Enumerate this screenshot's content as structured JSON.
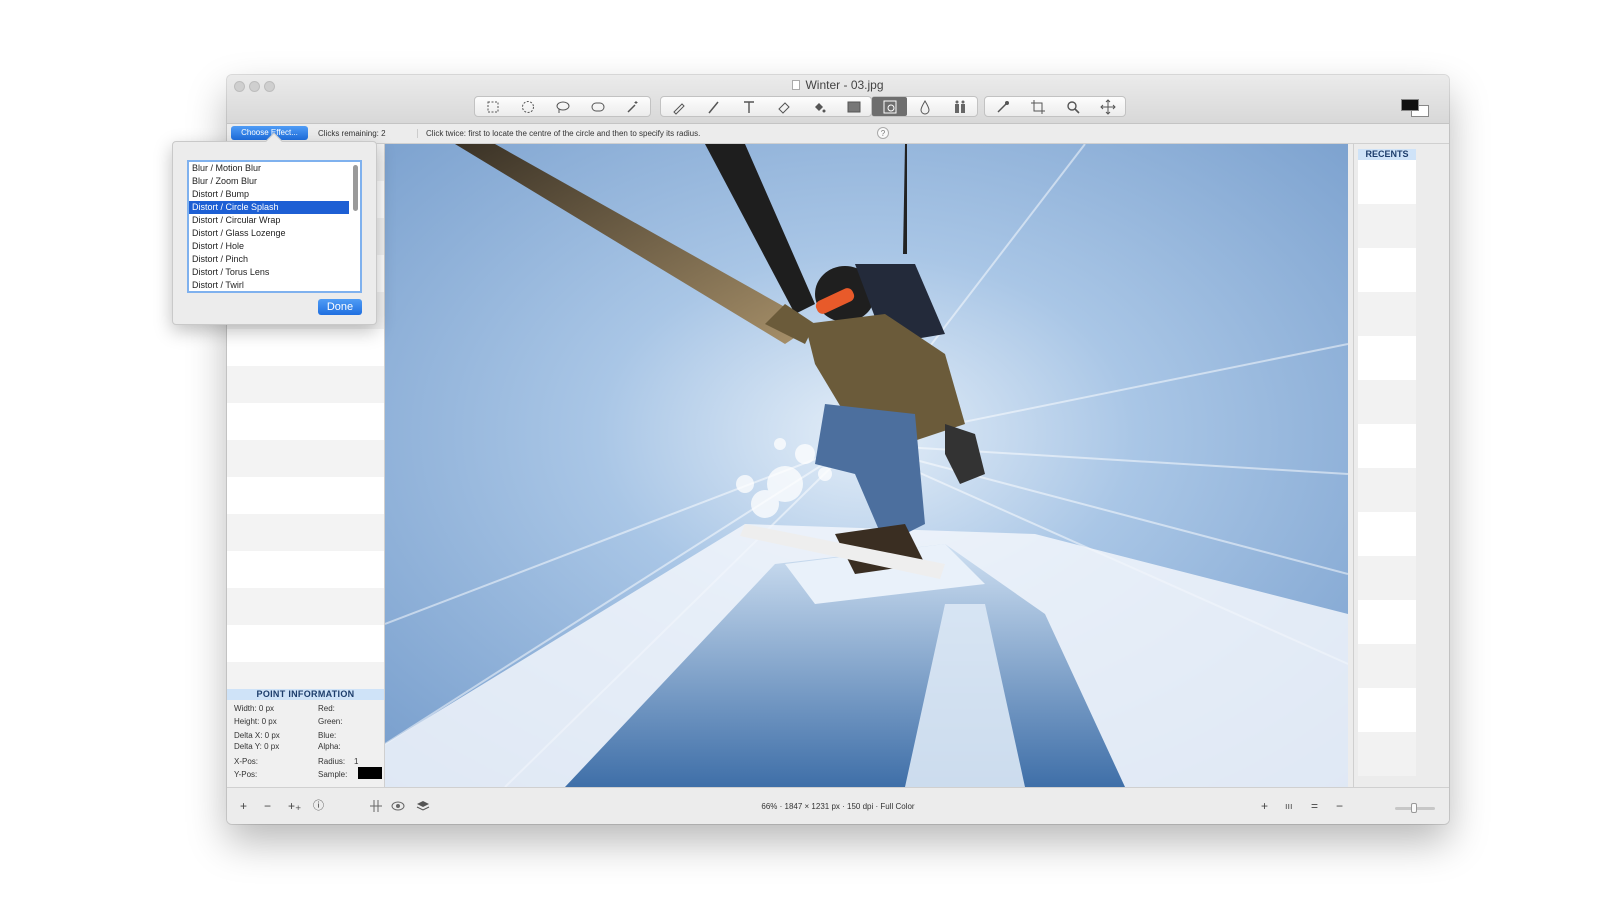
{
  "window": {
    "title": "Winter - 03.jpg"
  },
  "toolbar": {
    "groups": [
      [
        "rect-select-icon",
        "ellipse-select-icon",
        "lasso-icon",
        "polygon-select-icon",
        "magic-wand-icon"
      ],
      [
        "pencil-icon",
        "brush-icon",
        "text-icon",
        "eraser-icon",
        "paint-bucket-icon",
        "gradient-icon"
      ],
      [
        "effects-icon",
        "blur-drop-icon",
        "clone-icon"
      ],
      [
        "eyedropper-icon",
        "crop-icon",
        "zoom-icon",
        "move-icon"
      ]
    ],
    "active_tool": "effects-icon"
  },
  "options": {
    "choose_effect_label": "Choose Effect...",
    "clicks_remaining": "Clicks remaining: 2",
    "hint": "Click twice: first to locate the centre of the circle and then to specify its radius.",
    "help": "?"
  },
  "effects_popover": {
    "items": [
      "Blur / Motion Blur",
      "Blur / Zoom Blur",
      "Distort / Bump",
      "Distort / Circle Splash",
      "Distort / Circular Wrap",
      "Distort / Glass Lozenge",
      "Distort / Hole",
      "Distort / Pinch",
      "Distort / Torus Lens",
      "Distort / Twirl"
    ],
    "selected_index": 3,
    "done_label": "Done"
  },
  "point_info": {
    "header": "POINT INFORMATION",
    "width": "Width:  0 px",
    "height": "Height:  0 px",
    "delta_x": "Delta X: 0 px",
    "delta_y": "Delta Y: 0 px",
    "x_pos": "X-Pos:",
    "y_pos": "Y-Pos:",
    "red": "Red:",
    "green": "Green:",
    "blue": "Blue:",
    "alpha": "Alpha:",
    "radius_label": "Radius:",
    "radius_value": "1",
    "sample": "Sample:",
    "sample_color": "#000000"
  },
  "recents": {
    "header": "RECENTS"
  },
  "statusbar": {
    "info": "66% · 1847 × 1231 px · 150 dpi · Full Color",
    "left_buttons": [
      "+",
      "−",
      "+₊",
      "ⓘ"
    ],
    "right_buttons": [
      "+",
      "ııı",
      "=",
      "−"
    ]
  },
  "colors": {
    "accent": "#1f6fe0",
    "panel_header": "#cfe3f8",
    "sky": "#8fb6e0"
  }
}
